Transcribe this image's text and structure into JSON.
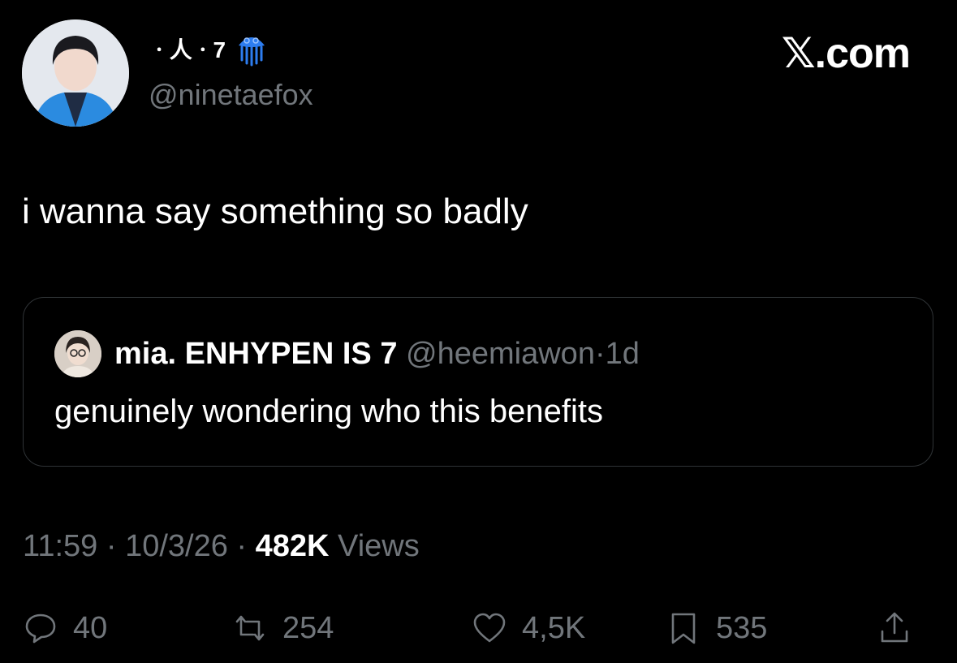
{
  "author": {
    "display_name": "ㆍ人ㆍ7",
    "handle": "@ninetaefox",
    "badge_icon": "jellyfish-icon"
  },
  "brand": "𝕏.com",
  "tweet": {
    "text": "i wanna say something so badly"
  },
  "quoted": {
    "name": "mia. ENHYPEN IS 7",
    "handle": "@heemiawon",
    "sep": "·",
    "age": "1d",
    "text": "genuinely wondering who this benefits"
  },
  "meta": {
    "time": "11:59",
    "sep1": " · ",
    "date": "10/3/26",
    "sep2": " · ",
    "views_count": "482K",
    "views_label": " Views"
  },
  "actions": {
    "replies": "40",
    "reposts": "254",
    "likes": "4,5K",
    "bookmarks": "535"
  },
  "colors": {
    "background": "#000000",
    "text": "#e7e9ea",
    "secondary": "#71767b",
    "border": "#2f3336",
    "jelly": "#2d7df0"
  }
}
